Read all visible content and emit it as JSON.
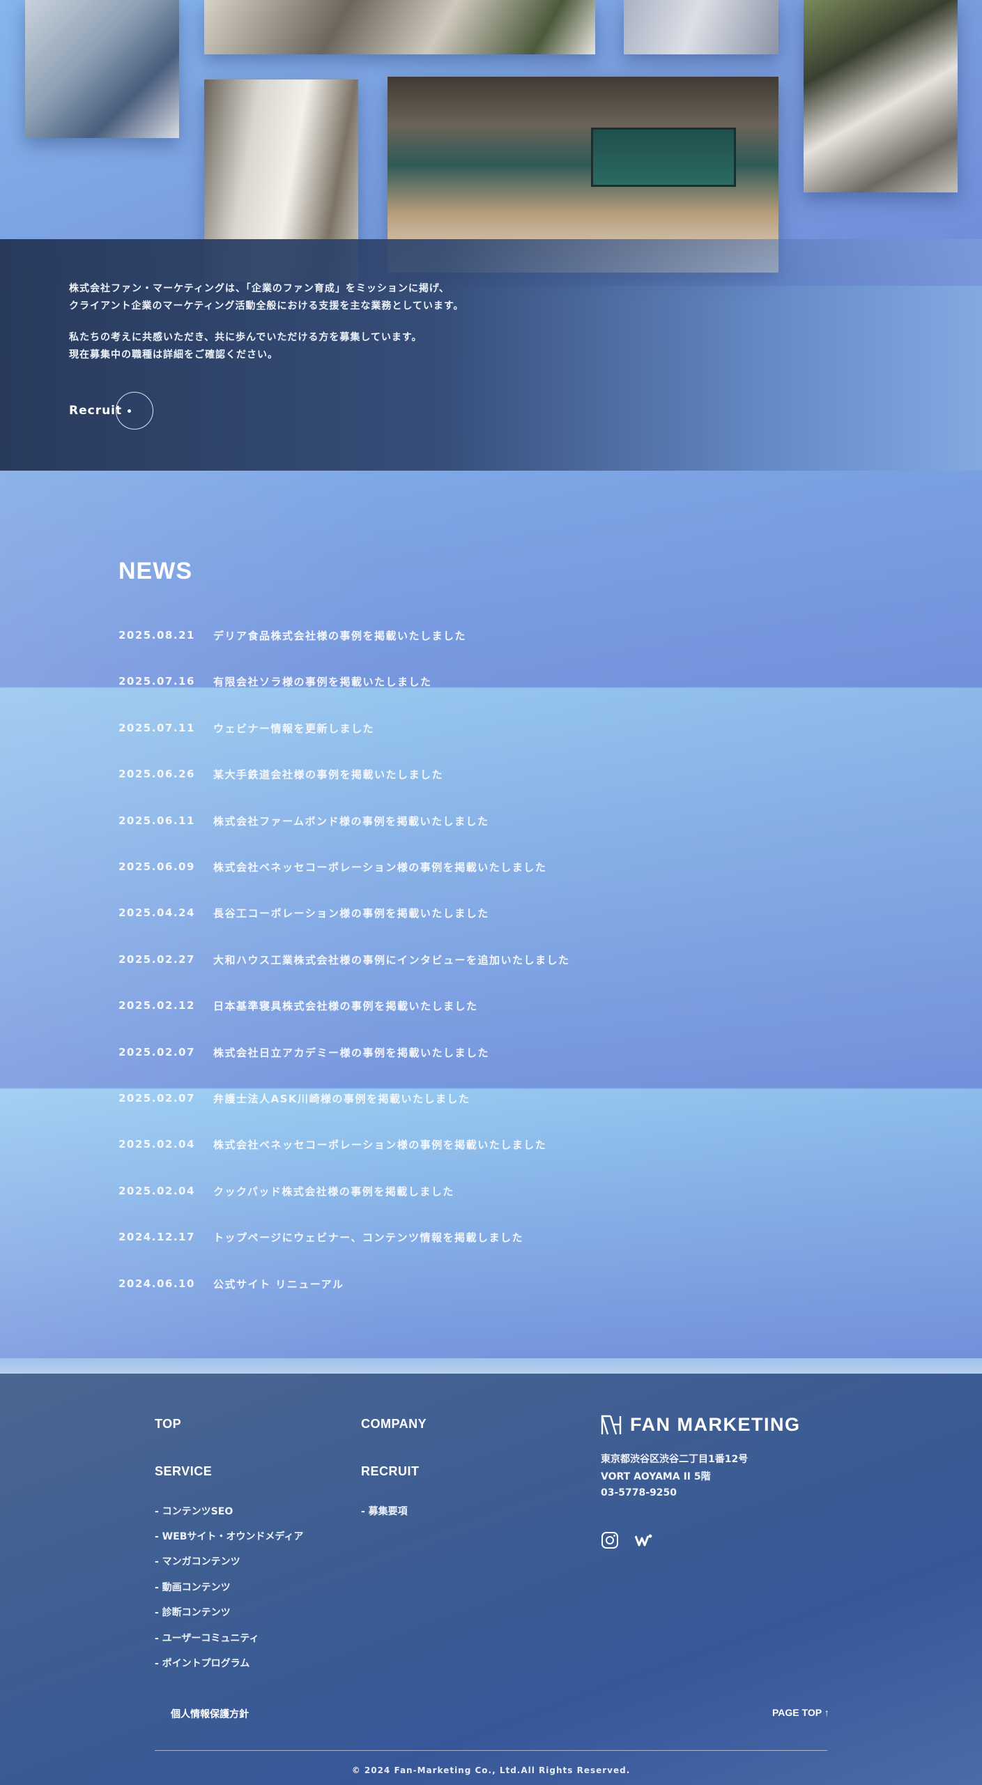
{
  "intro": {
    "paragraph1_line1": "株式会社ファン・マーケティングは、「企業のファン育成」をミッションに掲げ、",
    "paragraph1_line2": "クライアント企業のマーケティング活動全般における支援を主な業務としています。",
    "paragraph2_line1": "私たちの考えに共感いただき、共に歩んでいただける方を募集しています。",
    "paragraph2_line2": "現在募集中の職種は詳細をご確認ください。",
    "recruit_label": "Recruit"
  },
  "news": {
    "title": "NEWS",
    "items": [
      {
        "date": "2025.08.21",
        "title": "デリア食品株式会社様の事例を掲載いたしました"
      },
      {
        "date": "2025.07.16",
        "title": "有限会社ソラ様の事例を掲載いたしました"
      },
      {
        "date": "2025.07.11",
        "title": "ウェビナー情報を更新しました"
      },
      {
        "date": "2025.06.26",
        "title": "某大手鉄道会社様の事例を掲載いたしました"
      },
      {
        "date": "2025.06.11",
        "title": "株式会社ファームボンド様の事例を掲載いたしました"
      },
      {
        "date": "2025.06.09",
        "title": "株式会社ベネッセコーポレーション様の事例を掲載いたしました"
      },
      {
        "date": "2025.04.24",
        "title": "長谷工コーポレーション様の事例を掲載いたしました"
      },
      {
        "date": "2025.02.27",
        "title": "大和ハウス工業株式会社様の事例にインタビューを追加いたしました"
      },
      {
        "date": "2025.02.12",
        "title": "日本基準寝具株式会社様の事例を掲載いたしました"
      },
      {
        "date": "2025.02.07",
        "title": "株式会社日立アカデミー様の事例を掲載いたしました"
      },
      {
        "date": "2025.02.07",
        "title": "弁護士法人ASK川崎様の事例を掲載いたしました"
      },
      {
        "date": "2025.02.04",
        "title": "株式会社ベネッセコーポレーション様の事例を掲載いたしました"
      },
      {
        "date": "2025.02.04",
        "title": "クックパッド株式会社様の事例を掲載しました"
      },
      {
        "date": "2024.12.17",
        "title": "トップページにウェビナー、コンテンツ情報を掲載しました"
      },
      {
        "date": "2024.06.10",
        "title": "公式サイト リニューアル"
      }
    ]
  },
  "footer": {
    "nav": {
      "top": "TOP",
      "company": "COMPANY",
      "service": "SERVICE",
      "recruit": "RECRUIT",
      "service_links": [
        "- コンテンツSEO",
        "- WEBサイト・オウンドメディア",
        "- マンガコンテンツ",
        "- 動画コンテンツ",
        "- 診断コンテンツ",
        "- ユーザーコミュニティ",
        "- ポイントプログラム"
      ],
      "recruit_links": [
        "- 募集要項"
      ]
    },
    "brand_name": "FAN MARKETING",
    "address_line1": "東京都渋谷区渋谷二丁目1番12号",
    "address_line2": "VORT AOYAMA II 5階",
    "phone": "03-5778-9250",
    "privacy": "個人情報保護方針",
    "page_top": "PAGE TOP ↑",
    "copyright": "© 2024 Fan-Marketing Co., Ltd.All Rights Reserved."
  }
}
